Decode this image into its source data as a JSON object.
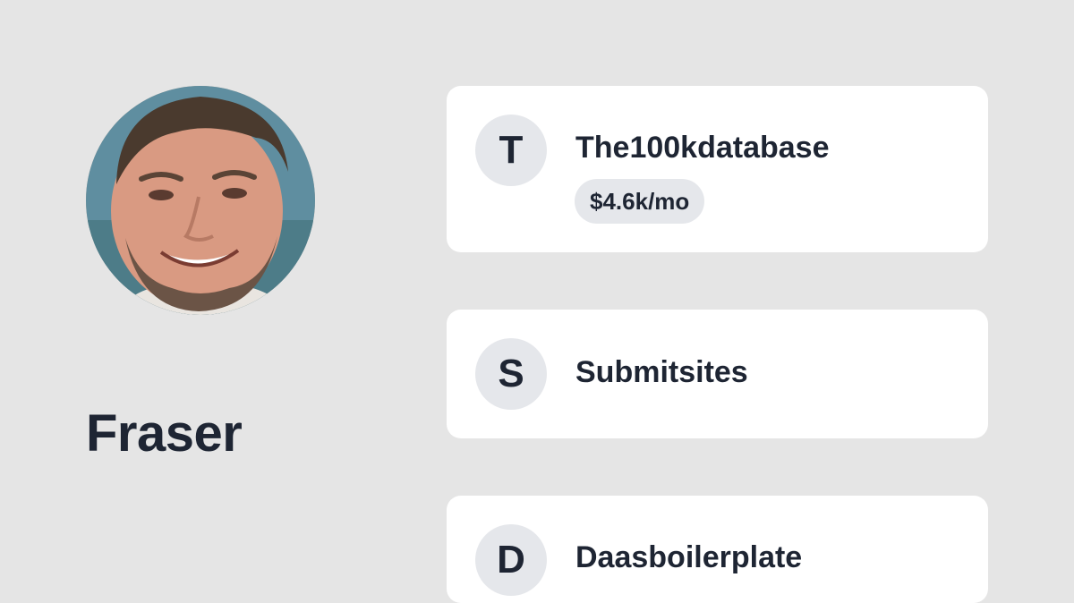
{
  "profile": {
    "name": "Fraser",
    "avatar_icon": "person-photo"
  },
  "products": [
    {
      "initial": "T",
      "name": "The100kdatabase",
      "revenue": "$4.6k/mo"
    },
    {
      "initial": "S",
      "name": "Submitsites"
    },
    {
      "initial": "D",
      "name": "Daasboilerplate"
    }
  ],
  "colors": {
    "background": "#e5e5e5",
    "card": "#ffffff",
    "circle": "#e5e7eb",
    "text": "#1e2533"
  }
}
